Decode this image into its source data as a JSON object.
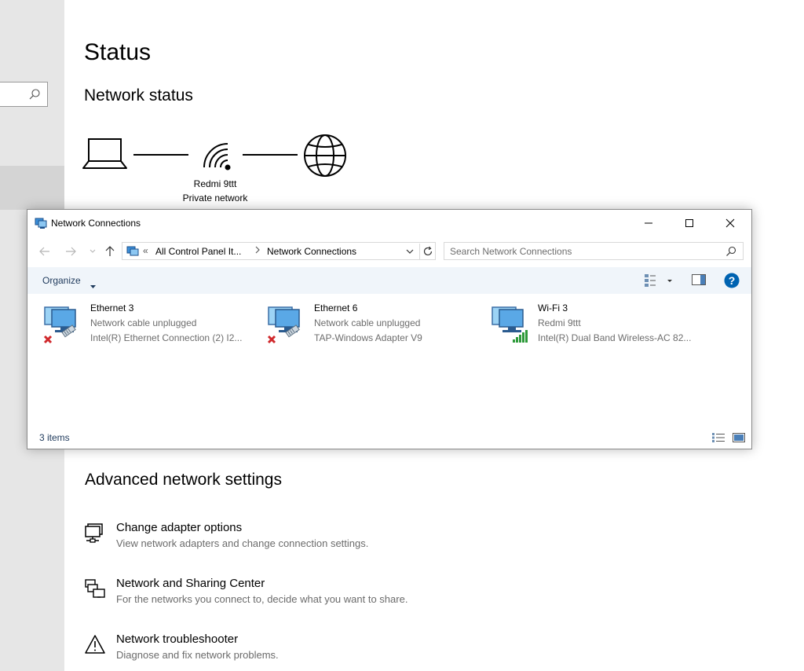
{
  "settings": {
    "title": "Status",
    "network_status_heading": "Network status",
    "diagram": {
      "ssid": "Redmi 9ttt",
      "network_type": "Private network"
    },
    "advanced_heading": "Advanced network settings",
    "advanced_items": [
      {
        "title": "Change adapter options",
        "desc": "View network adapters and change connection settings.",
        "icon": "adapter-icon"
      },
      {
        "title": "Network and Sharing Center",
        "desc": "For the networks you connect to, decide what you want to share.",
        "icon": "sharing-center-icon"
      },
      {
        "title": "Network troubleshooter",
        "desc": "Diagnose and fix network problems.",
        "icon": "warning-icon"
      }
    ]
  },
  "nc_window": {
    "title": "Network Connections",
    "address": {
      "overflow": "«",
      "crumbs": [
        "All Control Panel It...",
        "Network Connections"
      ]
    },
    "search_placeholder": "Search Network Connections",
    "organize_label": "Organize",
    "connections": [
      {
        "name": "Ethernet 3",
        "status": "Network cable unplugged",
        "adapter": "Intel(R) Ethernet Connection (2) I2...",
        "state": "disconnected"
      },
      {
        "name": "Ethernet 6",
        "status": "Network cable unplugged",
        "adapter": "TAP-Windows Adapter V9",
        "state": "disconnected"
      },
      {
        "name": "Wi-Fi 3",
        "status": "Redmi 9ttt",
        "adapter": "Intel(R) Dual Band Wireless-AC 82...",
        "state": "connected"
      }
    ],
    "item_count": "3 items"
  },
  "colors": {
    "accent_blue": "#0063b1",
    "status_error": "#d0282c",
    "signal_green": "#2e9a3a",
    "command_bar": "#f0f5fa",
    "left_pane": "#e6e6e6"
  }
}
